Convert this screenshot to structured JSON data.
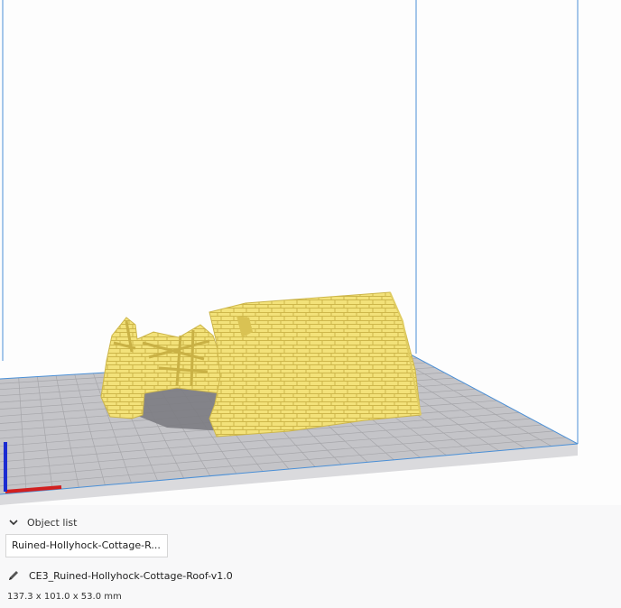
{
  "colors": {
    "background": "#fdfdfd",
    "build_plate": "#c4c4c8",
    "grid": "#a4a4a8",
    "volume_border": "#4a8fd6",
    "model": "#f3e27a",
    "model_dark": "#d2bd4c",
    "shadow": "#7a7a80",
    "axis_x": "#d11f1f",
    "axis_y": "#1a2bd1"
  },
  "icons": {
    "collapse": "chevron-down-icon",
    "edit": "pencil-icon"
  },
  "object_list": {
    "header": "Object list",
    "items": [
      "Ruined-Hollyhock-Cottage-R..."
    ]
  },
  "model_info": {
    "filename": "CE3_Ruined-Hollyhock-Cottage-Roof-v1.0",
    "dimensions": "137.3 x 101.0 x 53.0 mm"
  }
}
